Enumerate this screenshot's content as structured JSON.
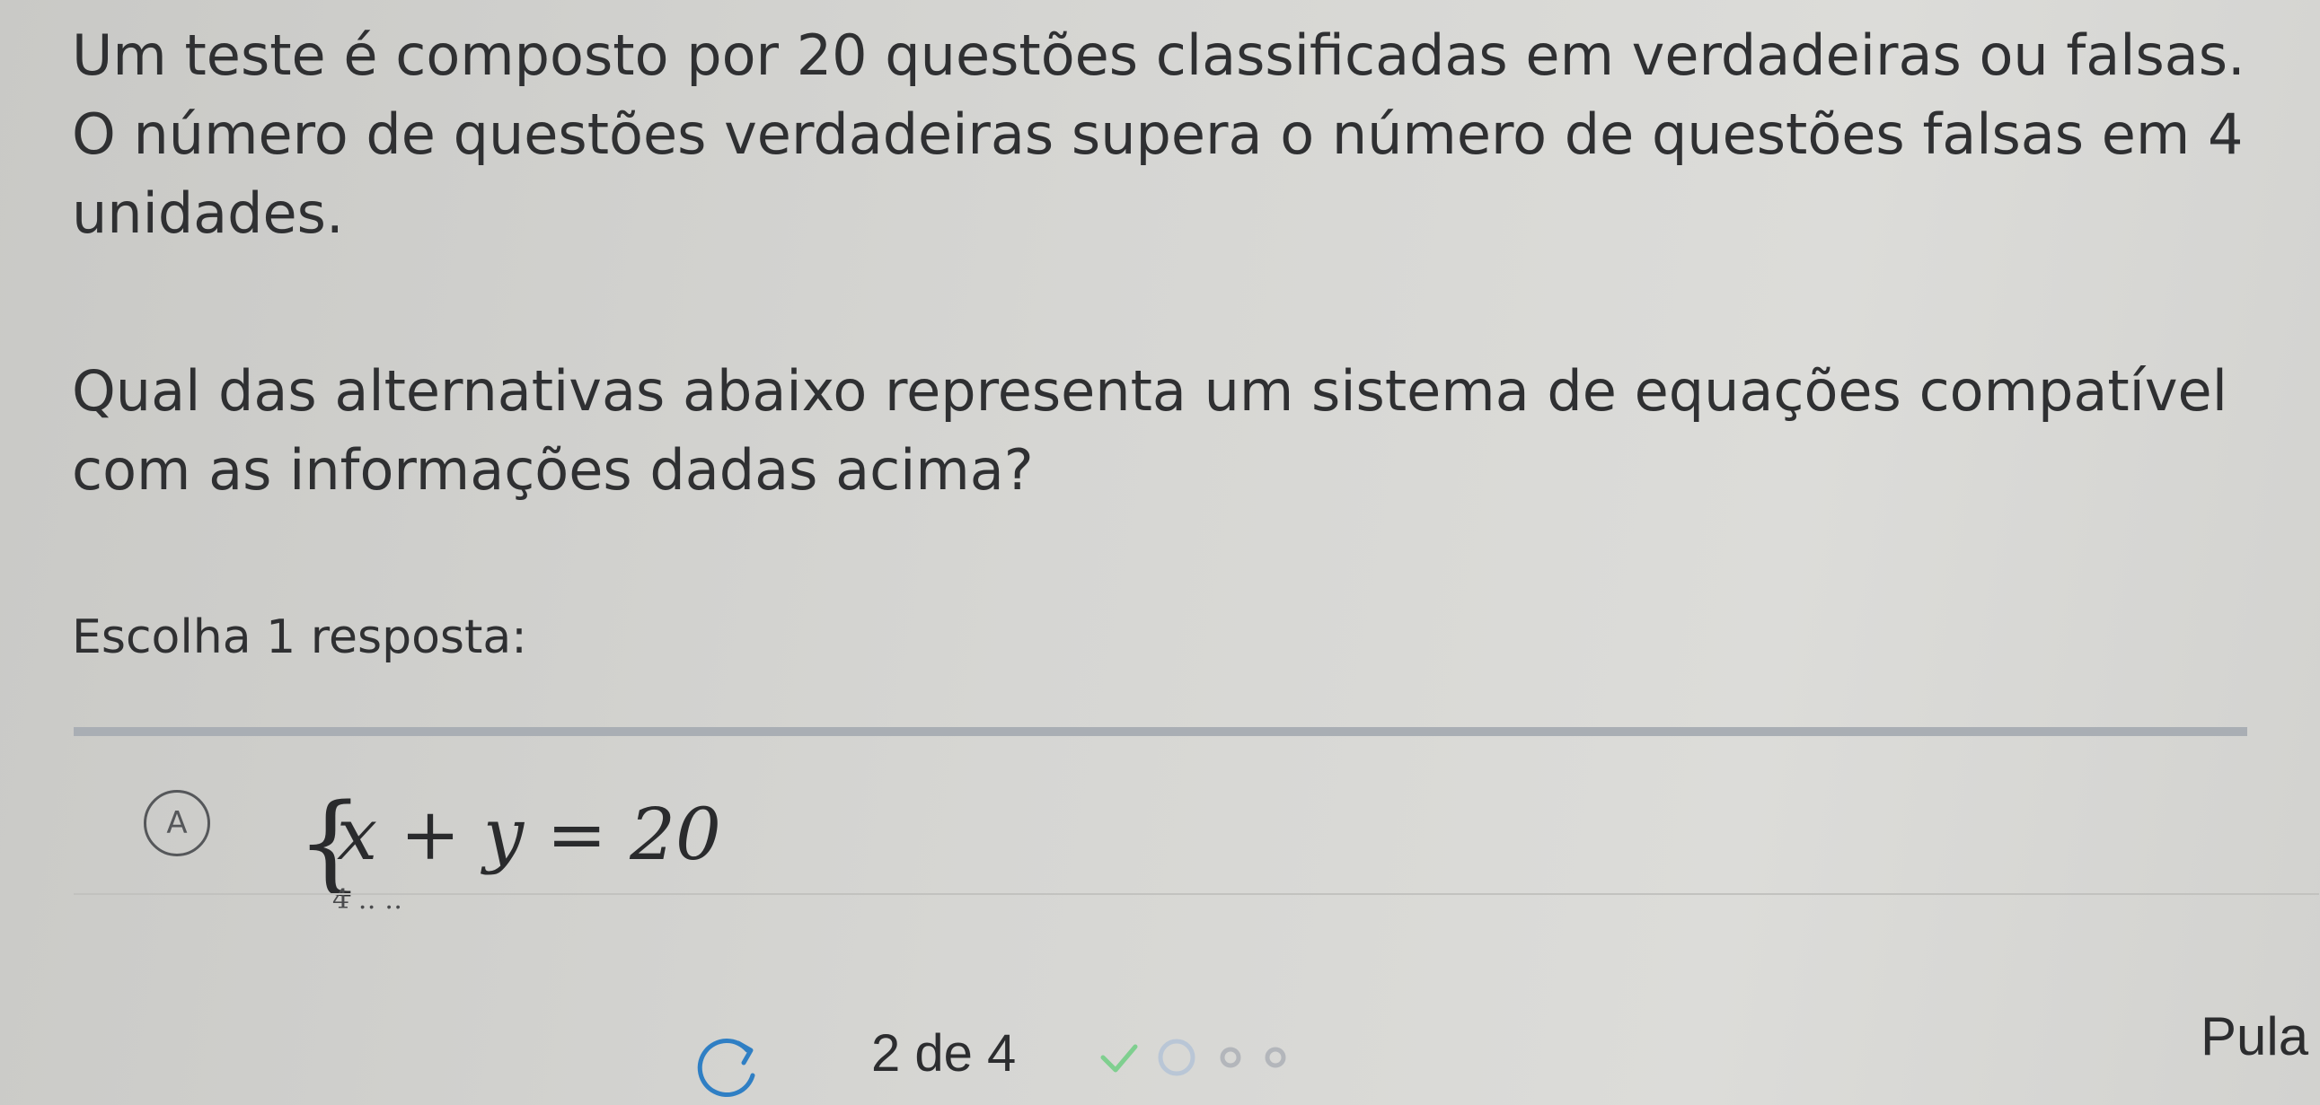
{
  "question": {
    "statement": "Um teste é composto por 20 questões classificadas em verdadeiras ou falsas. O número de questões verdadeiras supera o número de questões falsas em 4 unidades.",
    "prompt": "Qual das alternativas abaixo representa um sistema de equações compatível com as informações dadas acima?"
  },
  "instruction": "Escolha 1 resposta:",
  "options": [
    {
      "letter": "A",
      "eq1": "x + y = 20",
      "eq2_partial": "4 ‥ ‥"
    }
  ],
  "footer": {
    "progress_text": "2 de 4",
    "progress": {
      "current": 2,
      "total": 4,
      "completed": 1
    },
    "skip_label": "Pula",
    "icons": [
      "refresh-icon",
      "check-icon",
      "step-dot-icon"
    ]
  }
}
